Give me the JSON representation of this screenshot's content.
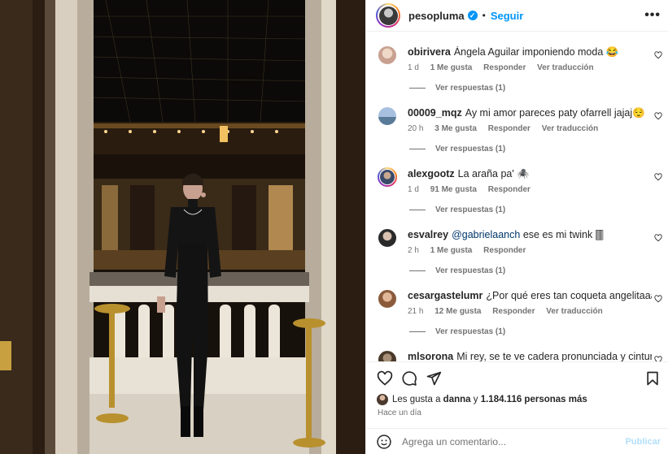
{
  "post": {
    "username": "pesopluma",
    "separator": "•",
    "follow_label": "Seguir",
    "more_icon": "ellipsis-icon",
    "verified_icon": "verified-badge-icon"
  },
  "comments": [
    {
      "user": "obirivera",
      "text": "Ángela Aguilar imponiendo moda 😂",
      "time": "1 d",
      "likes": "1 Me gusta",
      "reply": "Responder",
      "translate": "Ver traducción",
      "view_replies": "Ver respuestas (1)",
      "avatar_color": "#e8cfc0"
    },
    {
      "user": "00009_mqz",
      "text": "Ay mi amor pareces paty ofarrell jajaj😌",
      "time": "20 h",
      "likes": "3 Me gusta",
      "reply": "Responder",
      "translate": "Ver traducción",
      "view_replies": "Ver respuestas (1)",
      "avatar_color": "#8aa8c8"
    },
    {
      "user": "alexgootz",
      "text": "La araña pa' 🕷️",
      "time": "1 d",
      "likes": "91 Me gusta",
      "reply": "Responder",
      "translate": "",
      "view_replies": "Ver respuestas (1)",
      "avatar_color": "#4a5a7a"
    },
    {
      "user": "esvalrey",
      "text_before": "",
      "mention": "@gabrielaanch",
      "text": " ese es mi twink 🀫",
      "time": "2 h",
      "likes": "1 Me gusta",
      "reply": "Responder",
      "translate": "",
      "view_replies": "Ver respuestas (1)",
      "avatar_color": "#3a3a3a"
    },
    {
      "user": "cesargastelumr",
      "text": "¿Por qué eres tan coqueta angelitaaaa?😍",
      "time": "21 h",
      "likes": "12 Me gusta",
      "reply": "Responder",
      "translate": "Ver traducción",
      "view_replies": "Ver respuestas (1)",
      "avatar_color": "#c89070"
    },
    {
      "user": "mlsorona",
      "text": "Mi rey, se te ve cadera pronunciada y cintura",
      "time": "",
      "likes": "",
      "reply": "",
      "translate": "",
      "view_replies": "",
      "avatar_color": "#6a5a4a"
    }
  ],
  "actions": {
    "like_icon": "heart-icon",
    "comment_icon": "comment-icon",
    "share_icon": "send-icon",
    "save_icon": "bookmark-icon"
  },
  "likes": {
    "prefix": "Les gusta a",
    "user": "danna",
    "middle": "y",
    "count": "1.184.116 personas más"
  },
  "time_ago": "Hace un día",
  "add_comment": {
    "placeholder": "Agrega un comentario...",
    "publish_label": "Publicar",
    "emoji_icon": "smiley-icon"
  },
  "colors": {
    "accent": "#0095f6",
    "secondary_text": "#737373",
    "mention": "#00376b"
  }
}
